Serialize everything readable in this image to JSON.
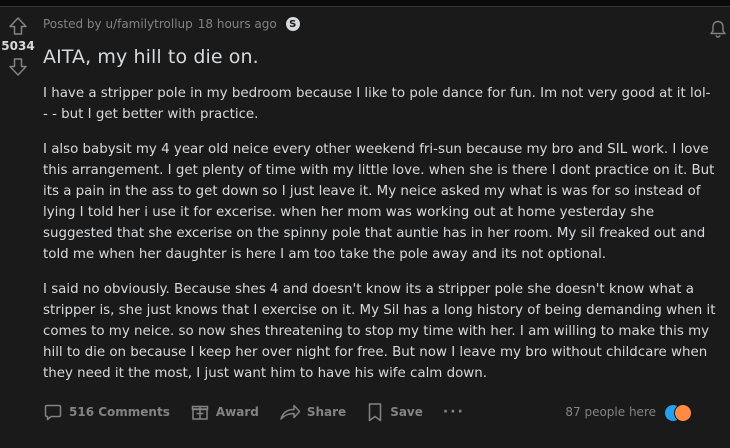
{
  "post": {
    "meta": {
      "posted_by": "Posted by u/familytrollup",
      "time": "18 hours ago"
    },
    "score": "5034",
    "title": "AITA, my hill to die on.",
    "paragraphs": [
      "I have a stripper pole in my bedroom because I like to pole dance for fun. Im not very good at it lol- - - but I get better with practice.",
      "I also babysit my 4 year old neice every other weekend fri-sun because my bro and SIL work. I love this arrangement. I get plenty of time with my little love. when she is there I dont practice on it. But its a pain in the ass to get down so I just leave it. My neice asked my what is was for so instead of lying I told her i use it for excerise. when her mom was working out at home yesterday she suggested that she excerise on the spinny pole that auntie has in her room. My sil freaked out and told me when her daughter is here I am too take the pole away and its not optional.",
      "I said no obviously. Because shes 4 and doesn't know its a stripper pole she doesn't know what a stripper is, she just knows that I exercise on it. My Sil has a long history of being demanding when it comes to my neice. so now shes threatening to stop my time with her. I am willing to make this my hill to die on because I keep her over night for free. But now I leave my bro without childcare when they need it the most, I just want him to have his wife calm down."
    ],
    "actions": {
      "comments": "516 Comments",
      "award": "Award",
      "share": "Share",
      "save": "Save",
      "more": "···"
    },
    "presence": "87 people here"
  },
  "icons": {
    "upvote": "arrow-up-icon",
    "downvote": "arrow-down-icon",
    "notification": "bell-icon",
    "comment": "comment-icon",
    "award": "gift-icon",
    "share": "share-arrow-icon",
    "save": "bookmark-icon",
    "more": "ellipsis-icon"
  },
  "colors": {
    "background": "#1a1a1b",
    "text": "#d7dadc",
    "muted": "#818384"
  }
}
